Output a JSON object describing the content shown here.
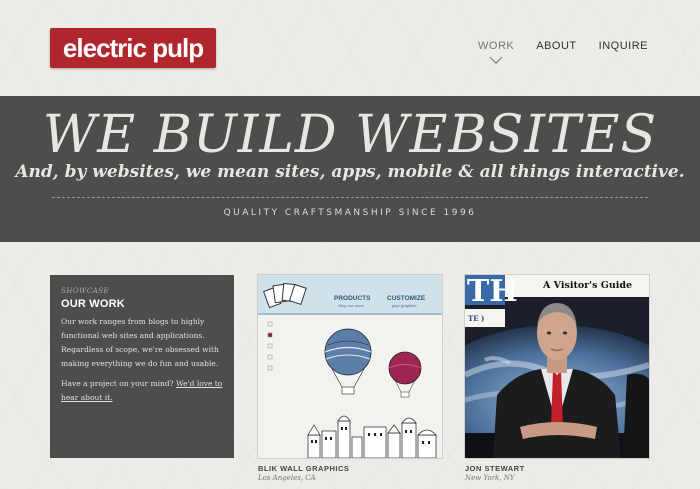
{
  "logo": {
    "text": "electric pulp"
  },
  "nav": {
    "items": [
      {
        "label": "WORK",
        "active": true
      },
      {
        "label": "ABOUT"
      },
      {
        "label": "INQUIRE"
      }
    ]
  },
  "hero": {
    "title": "WE BUILD WEBSITES",
    "subtitle": "And, by websites, we mean sites, apps, mobile & all things interactive.",
    "tagline": "QUALITY CRAFTSMANSHIP SINCE 1996"
  },
  "work_intro": {
    "eyebrow": "SHOWCASE",
    "title": "OUR WORK",
    "body": "Our work ranges from blogs to highly functional web sites and applications. Regardless of scope, we're obsessed with making everything we do fun and usable.",
    "cta_text": "Have a project on your mind?",
    "cta_link": "We'd love to hear about it."
  },
  "projects": [
    {
      "title": "BLIK WALL GRAPHICS",
      "location": "Los Angeles, CA",
      "thumb": {
        "nav_products": "PRODUCTS",
        "nav_products_sub": "shop our store",
        "nav_customize": "CUSTOMIZE",
        "nav_customize_sub": "your graphics"
      }
    },
    {
      "title": "JON STEWART",
      "location": "New York, NY",
      "thumb": {
        "headline": "A Visitor's Guide",
        "masthead": "TH",
        "side_text": "TE )"
      }
    }
  ],
  "colors": {
    "brand_red": "#b1262d",
    "hero_bg": "#4d4d4c",
    "page_bg": "#ecebe7"
  }
}
